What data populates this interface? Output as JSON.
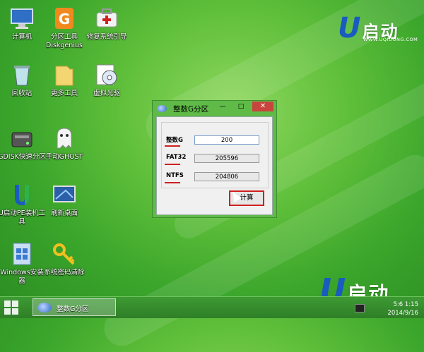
{
  "desktop_icons": [
    {
      "label": "计算机",
      "icon": "computer-icon"
    },
    {
      "label": "分区工具\nDiskgenius",
      "icon": "diskgenius-icon"
    },
    {
      "label": "修复系统引导",
      "icon": "toolbox-icon"
    },
    {
      "label": "回收站",
      "icon": "recycle-bin-icon"
    },
    {
      "label": "更多工具",
      "icon": "folder-icon"
    },
    {
      "label": "虚拟光驱",
      "icon": "virtual-drive-icon"
    },
    {
      "label": "GDISK快速分区",
      "icon": "gdisk-icon"
    },
    {
      "label": "手动GHOST",
      "icon": "ghost-icon"
    },
    {
      "label": "U启动PE装机工具",
      "icon": "u-installer-icon"
    },
    {
      "label": "刷新桌面",
      "icon": "refresh-desktop-icon"
    },
    {
      "label": "Windows安装器",
      "icon": "windows-installer-icon"
    },
    {
      "label": "系统密码清除",
      "icon": "key-icon"
    }
  ],
  "logo": {
    "u": "U",
    "cn": "启动",
    "url": "WWW.UQIDONG.COM"
  },
  "dialog": {
    "title": "整数G分区",
    "minimize": "—",
    "maximize": "□",
    "close": "✕",
    "rows": [
      {
        "label": "整数G",
        "value": "200"
      },
      {
        "label": "FAT32",
        "value": "205596"
      },
      {
        "label": "NTFS",
        "value": "204806"
      }
    ],
    "calc_button": "计算"
  },
  "taskbar": {
    "task_label": "整数G分区",
    "time": "5:6 1:15",
    "date": "2014/9/16"
  },
  "colors": {
    "accent_red": "#d01f1f",
    "desktop_green": "#5fbf3a"
  }
}
